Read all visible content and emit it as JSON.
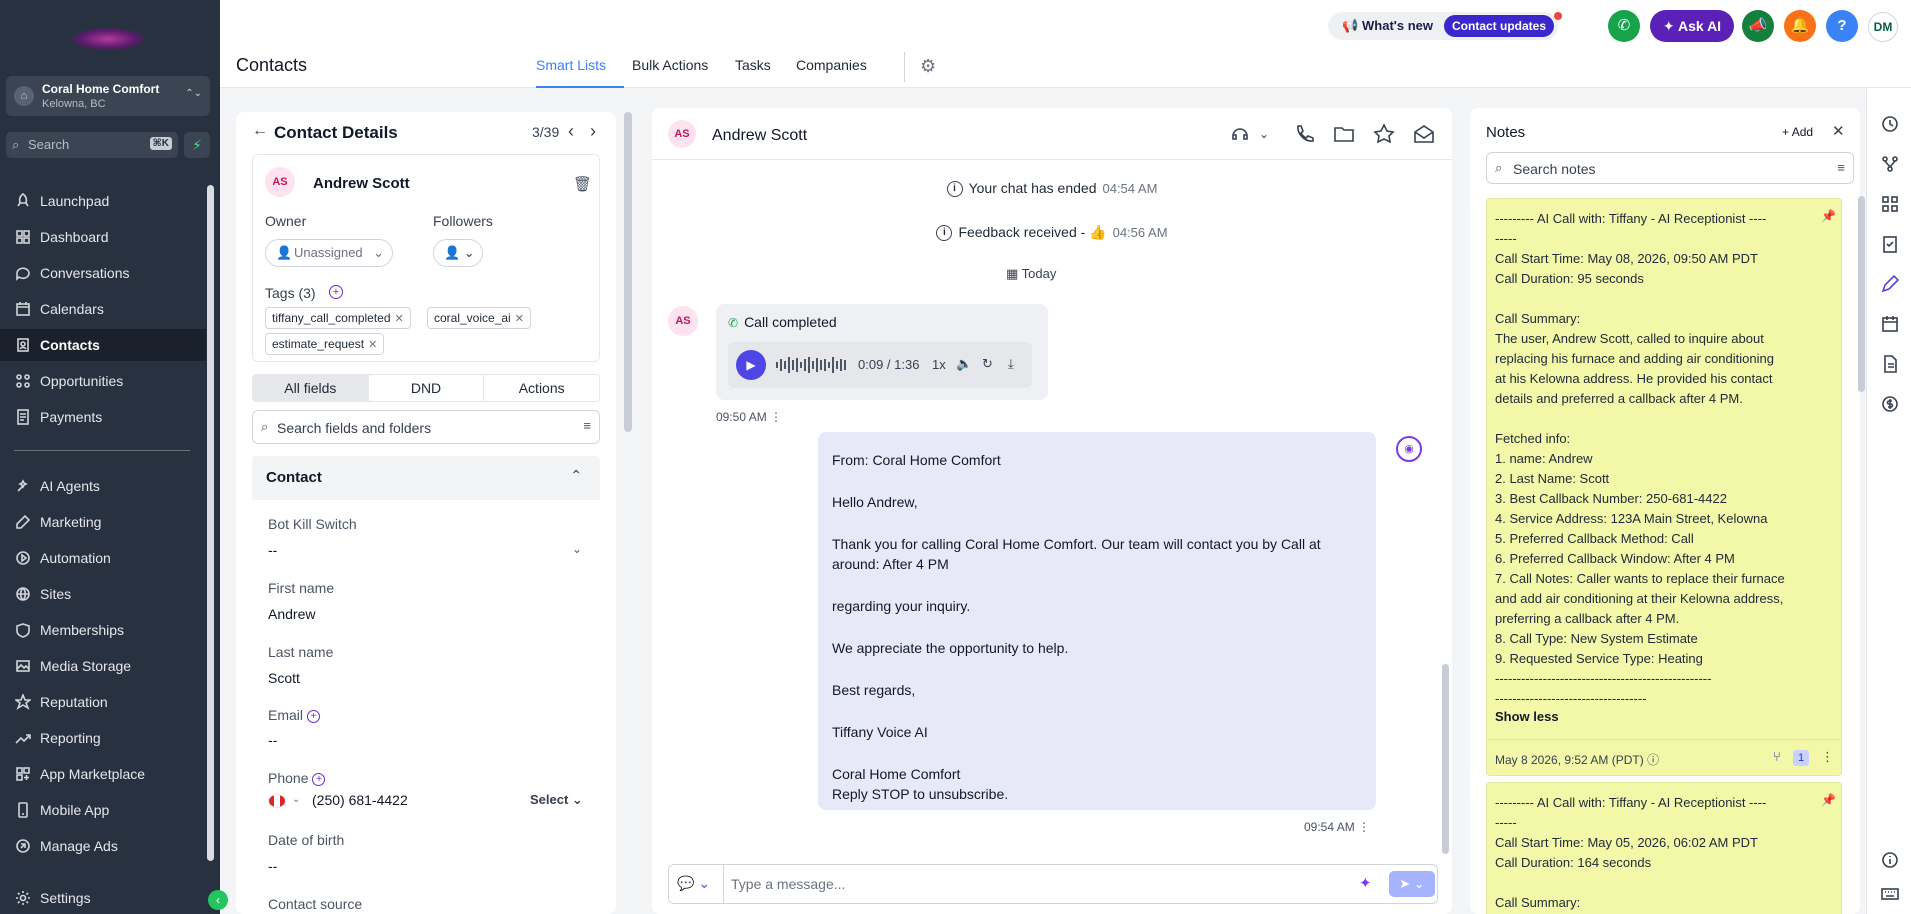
{
  "sidebar": {
    "location_name": "Coral Home Comfort",
    "location_sub": "Kelowna, BC",
    "search_placeholder": "Search",
    "search_shortcut": "⌘K",
    "items": [
      {
        "label": "Launchpad",
        "icon": "launchpad-icon"
      },
      {
        "label": "Dashboard",
        "icon": "dashboard-icon"
      },
      {
        "label": "Conversations",
        "icon": "chat-icon"
      },
      {
        "label": "Calendars",
        "icon": "calendar-icon"
      },
      {
        "label": "Contacts",
        "icon": "contacts-icon",
        "active": true
      },
      {
        "label": "Opportunities",
        "icon": "opportunities-icon"
      },
      {
        "label": "Payments",
        "icon": "payments-icon"
      },
      {
        "label": "AI Agents",
        "icon": "ai-agents-icon"
      },
      {
        "label": "Marketing",
        "icon": "marketing-icon"
      },
      {
        "label": "Automation",
        "icon": "automation-icon"
      },
      {
        "label": "Sites",
        "icon": "sites-icon"
      },
      {
        "label": "Memberships",
        "icon": "memberships-icon"
      },
      {
        "label": "Media Storage",
        "icon": "media-icon"
      },
      {
        "label": "Reputation",
        "icon": "star-icon"
      },
      {
        "label": "Reporting",
        "icon": "reporting-icon"
      },
      {
        "label": "App Marketplace",
        "icon": "marketplace-icon"
      },
      {
        "label": "Mobile App",
        "icon": "mobile-icon"
      },
      {
        "label": "Manage Ads",
        "icon": "ads-icon"
      },
      {
        "label": "Settings",
        "icon": "gear-icon"
      }
    ]
  },
  "topbar": {
    "whats_new": "What's new",
    "contact_updates": "Contact updates",
    "ask_ai": "Ask AI",
    "avatar_initials": "DM",
    "page_title": "Contacts",
    "tabs": [
      "Smart Lists",
      "Bulk Actions",
      "Tasks",
      "Companies"
    ]
  },
  "details": {
    "title": "Contact Details",
    "count": "3/39",
    "initials": "AS",
    "name": "Andrew Scott",
    "owner_label": "Owner",
    "owner_value": "Unassigned",
    "followers_label": "Followers",
    "tags_label": "Tags (3)",
    "tags": [
      "tiffany_call_completed",
      "coral_voice_ai",
      "estimate_request"
    ],
    "segments": [
      "All fields",
      "DND",
      "Actions"
    ],
    "field_search_placeholder": "Search fields and folders",
    "section_title": "Contact",
    "fields": {
      "bot_kill_label": "Bot Kill Switch",
      "bot_kill_value": "--",
      "first_name_label": "First name",
      "first_name_value": "Andrew",
      "last_name_label": "Last name",
      "last_name_value": "Scott",
      "email_label": "Email",
      "email_value": "--",
      "phone_label": "Phone",
      "phone_value": "(250) 681-4422",
      "phone_select": "Select",
      "dob_label": "Date of birth",
      "dob_value": "--",
      "source_label": "Contact source"
    }
  },
  "conversation": {
    "initials": "AS",
    "name": "Andrew Scott",
    "sys1_text": "Your chat has ended",
    "sys1_time": "04:54 AM",
    "sys2_text": "Feedback received - 👍",
    "sys2_time": "04:56 AM",
    "today": "Today",
    "call_initials": "AS",
    "call_title": "Call completed",
    "call_time": "0:09 / 1:36",
    "call_speed": "1x",
    "call_msg_time": "09:50 AM",
    "message_lines": [
      "From: Coral Home Comfort",
      "Hello Andrew,",
      "Thank you for calling Coral Home Comfort. Our team will contact you by Call at around: After 4 PM",
      "regarding your inquiry.",
      "We appreciate the opportunity to help.",
      "Best regards,",
      "Tiffany Voice AI",
      "Coral Home Comfort",
      "Reply STOP to unsubscribe."
    ],
    "message_time": "09:54 AM",
    "composer_placeholder": "Type a message..."
  },
  "notes": {
    "title": "Notes",
    "add_label": "Add",
    "search_placeholder": "Search notes",
    "note1_lines": [
      "--------- AI Call with: Tiffany - AI Receptionist ----",
      "-----",
      "Call Start Time: May 08, 2026, 09:50 AM PDT",
      "Call Duration: 95 seconds",
      "",
      "Call Summary:",
      "The user, Andrew Scott, called to inquire about",
      "replacing his furnace and adding air conditioning",
      "at his Kelowna address. He provided his contact",
      "details and preferred a callback after 4 PM.",
      "",
      "Fetched info:",
      "1. name: Andrew",
      "2. Last Name: Scott",
      "3. Best Callback Number: 250-681-4422",
      "4. Service Address: 123A Main Street, Kelowna",
      "5. Preferred Callback Method: Call",
      "6. Preferred Callback Window: After 4 PM",
      "7. Call Notes: Caller wants to replace their furnace",
      "and add air conditioning at their Kelowna address,",
      "preferring a callback after 4 PM.",
      "8. Call Type: New System Estimate",
      "9. Requested Service Type: Heating",
      "--------------------------------------------------",
      "-----------------------------------"
    ],
    "show_less": "Show less",
    "note1_footer": "May 8 2026, 9:52 AM (PDT)",
    "note1_badge": "1",
    "note2_lines": [
      "--------- AI Call with: Tiffany - AI Receptionist ----",
      "-----",
      "Call Start Time: May 05, 2026, 06:02 AM PDT",
      "Call Duration: 164 seconds",
      "",
      "Call Summary:"
    ]
  }
}
